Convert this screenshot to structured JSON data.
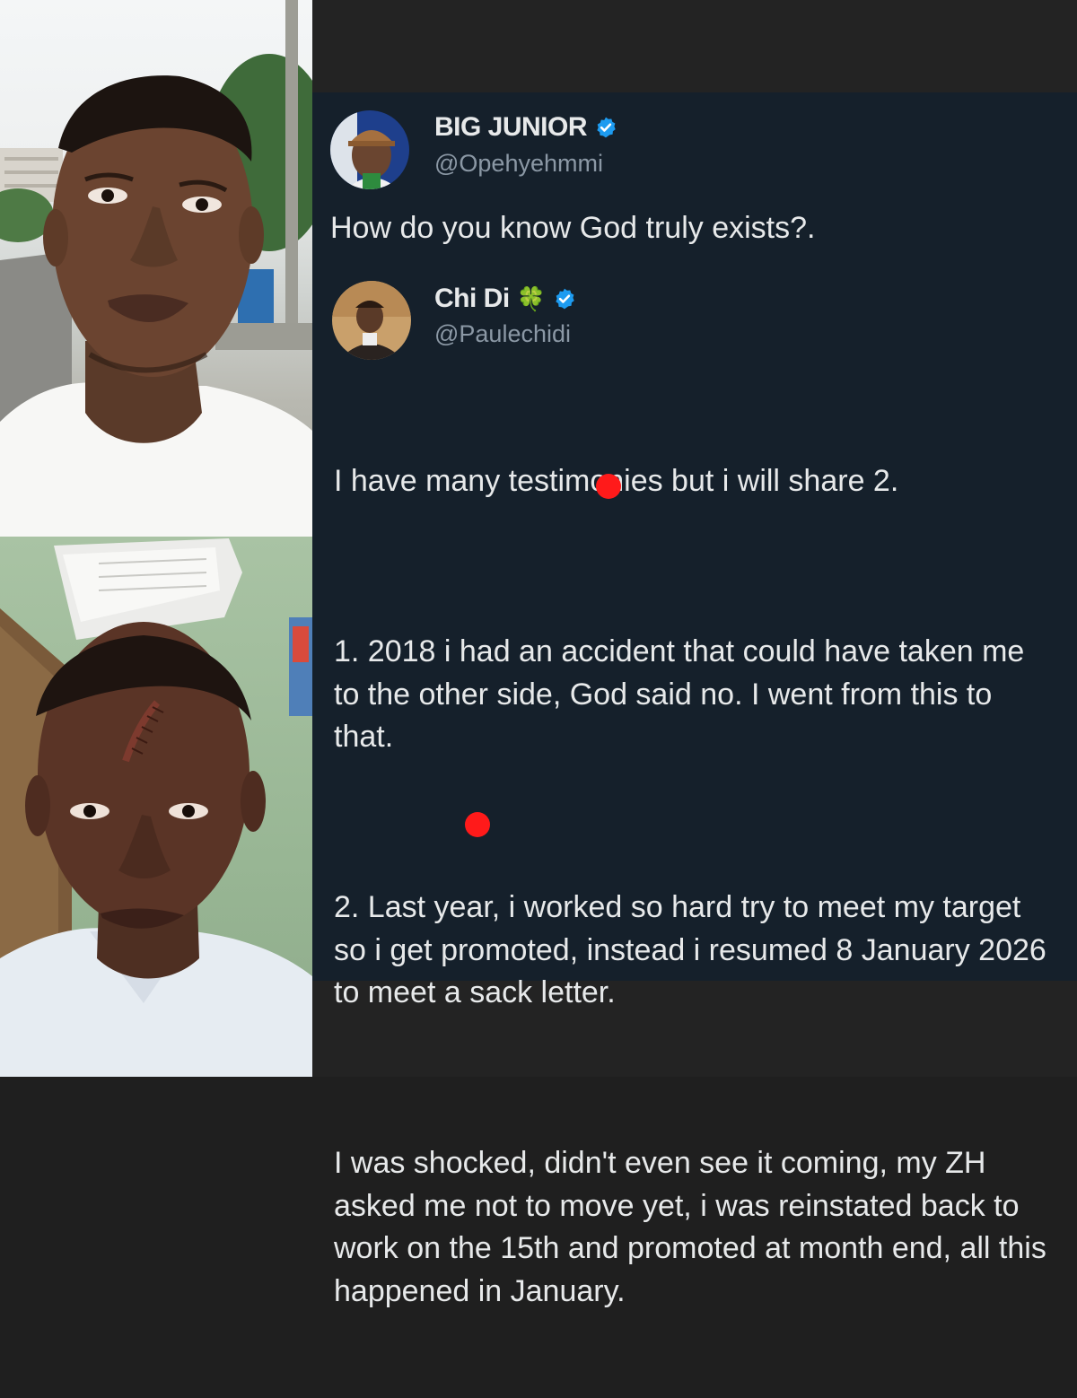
{
  "photos": {
    "top": {
      "description_icon": "man-selfie-photo"
    },
    "bottom": {
      "description_icon": "man-with-scar-photo"
    }
  },
  "original_tweet": {
    "display_name": "BIG JUNIOR",
    "handle": "@Opehyehmmi",
    "text": "How do you know God truly exists?."
  },
  "reply_tweet": {
    "display_name": "Chi Di",
    "name_emoji": "🍀",
    "handle": "@Paulechidi",
    "paragraphs": [
      "I have many testimonies but i will share 2.",
      "1. 2018 i had an accident that could have taken me to the other side, God said no. I went from this to that.",
      "2. Last year, i worked so hard try to meet my target so i get promoted, instead i resumed 8 January 2026 to meet a sack letter.",
      "I was shocked, didn't even see it coming, my ZH asked me not to move yet, i was reinstated back to work on the 15th and promoted at month end, all this happened in January."
    ]
  },
  "colors": {
    "background": "#15202b",
    "text": "#e7e9ea",
    "secondary_text": "#8b98a5",
    "verified_badge": "#1d9bf0",
    "redaction_dot": "#ff1a1a"
  }
}
